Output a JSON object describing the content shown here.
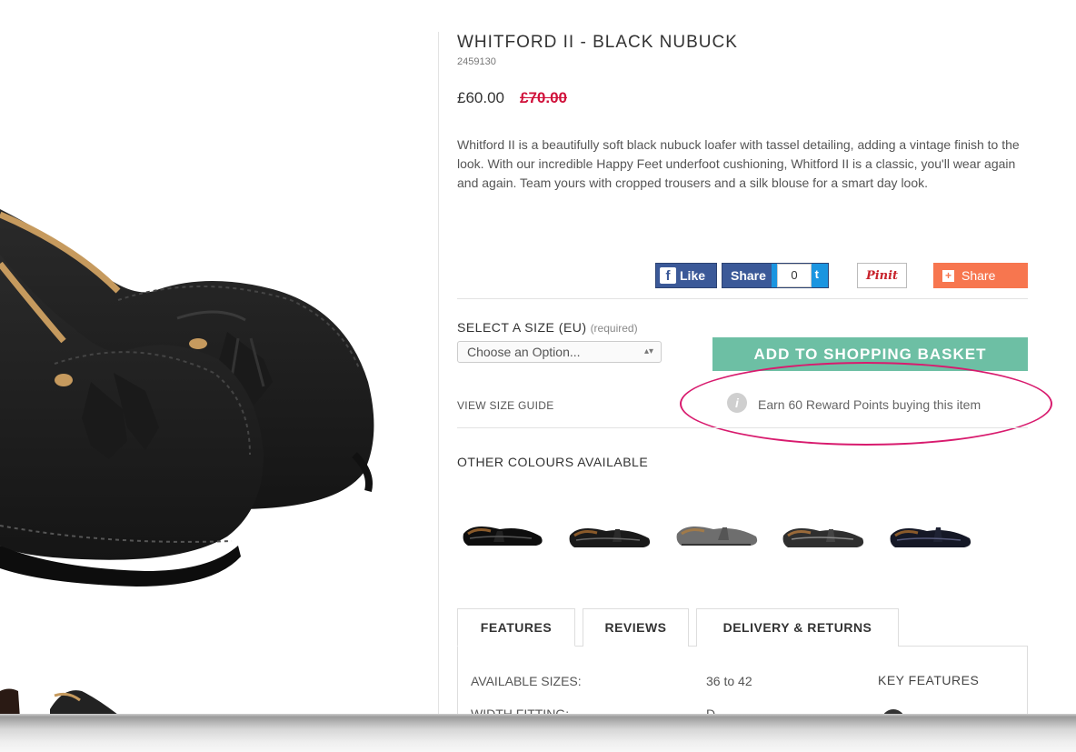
{
  "product": {
    "title": "WHITFORD II - BLACK NUBUCK",
    "sku": "2459130",
    "price": "£60.00",
    "old_price": "£70.00",
    "description": "Whitford II is a beautifully soft black nubuck loafer with tassel detailing, adding a vintage finish to the look. With our incredible Happy Feet underfoot cushioning, Whitford II is a classic, you'll wear again and again. Team yours with cropped trousers and a silk blouse for a smart day look."
  },
  "social": {
    "fb_icon": "f",
    "fb_like": "Like",
    "share": "Share",
    "tweet_count": "0",
    "tweet_fragment": "t",
    "pinit": "Pinit",
    "addthis_icon": "+",
    "addthis_share": "Share"
  },
  "size": {
    "label": "SELECT A SIZE (EU)",
    "required": "(required)",
    "select_value": "Choose an Option...",
    "select_arrows": "▴▾",
    "guide_link": "VIEW SIZE GUIDE"
  },
  "basket": {
    "button_label": "ADD TO SHOPPING BASKET"
  },
  "reward": {
    "icon": "i",
    "text": "Earn 60 Reward Points buying this item"
  },
  "colours": {
    "label": "OTHER COLOURS AVAILABLE",
    "swatches": [
      "black patent",
      "black croc",
      "grey suede",
      "black grey croc",
      "navy patent"
    ]
  },
  "tabs": [
    "FEATURES",
    "REVIEWS",
    "DELIVERY & RETURNS"
  ],
  "features": {
    "available_sizes_label": "AVAILABLE SIZES:",
    "available_sizes_value": "36 to 42",
    "width_label": "WIDTH FITTING:",
    "width_value": "D",
    "key_features": "KEY FEATURES"
  },
  "colors": {
    "accent_green": "#6dbfa4",
    "sale_red": "#d0103a",
    "highlight_pink": "#d81b6e",
    "facebook_blue": "#3b5998",
    "share_orange": "#f7764f"
  }
}
